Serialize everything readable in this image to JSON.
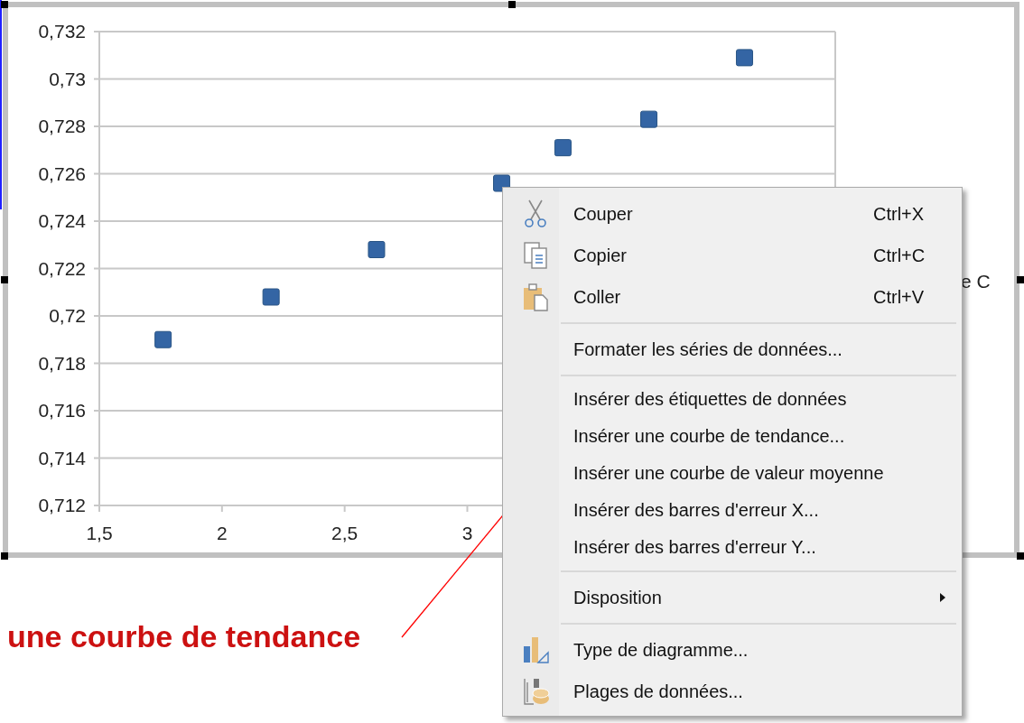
{
  "chart": {
    "chart_data": {
      "type": "scatter",
      "grid": true,
      "x": [
        1.76,
        2.2,
        2.63,
        3.14,
        3.39,
        3.74,
        4.13
      ],
      "series": [
        {
          "name": "e C",
          "color": "#3465a4",
          "values": [
            0.719,
            0.7208,
            0.7228,
            0.7256,
            0.7271,
            0.7283,
            0.7309
          ]
        }
      ],
      "xlim": [
        1.5,
        4.5
      ],
      "ylim": [
        0.712,
        0.732
      ],
      "xticks": [
        {
          "value": 1.5,
          "label": "1,5"
        },
        {
          "value": 2,
          "label": "2"
        },
        {
          "value": 2.5,
          "label": "2,5"
        },
        {
          "value": 3,
          "label": "3"
        }
      ],
      "yticks": [
        {
          "value": 0.712,
          "label": "0,712"
        },
        {
          "value": 0.714,
          "label": "0,714"
        },
        {
          "value": 0.716,
          "label": "0,716"
        },
        {
          "value": 0.718,
          "label": "0,718"
        },
        {
          "value": 0.72,
          "label": "0,72"
        },
        {
          "value": 0.722,
          "label": "0,722"
        },
        {
          "value": 0.724,
          "label": "0,724"
        },
        {
          "value": 0.726,
          "label": "0,726"
        },
        {
          "value": 0.728,
          "label": "0,728"
        },
        {
          "value": 0.73,
          "label": "0,73"
        },
        {
          "value": 0.732,
          "label": "0,732"
        }
      ]
    }
  },
  "context_menu": {
    "items": [
      {
        "kind": "cut",
        "label": "Couper",
        "shortcut": "Ctrl+X"
      },
      {
        "kind": "copy",
        "label": "Copier",
        "shortcut": "Ctrl+C"
      },
      {
        "kind": "paste",
        "label": "Coller",
        "shortcut": "Ctrl+V"
      },
      {
        "kind": "separator"
      },
      {
        "kind": "item",
        "label": "Formater les séries de données..."
      },
      {
        "kind": "separator"
      },
      {
        "kind": "compact",
        "label": "Insérer des étiquettes de données"
      },
      {
        "kind": "compact",
        "label": "Insérer une courbe de tendance..."
      },
      {
        "kind": "compact",
        "label": "Insérer une courbe de valeur moyenne"
      },
      {
        "kind": "compact",
        "label": "Insérer des barres d'erreur X..."
      },
      {
        "kind": "compact",
        "label": "Insérer des barres d'erreur Y..."
      },
      {
        "kind": "separator"
      },
      {
        "kind": "submenu",
        "label": "Disposition"
      },
      {
        "kind": "separator"
      },
      {
        "kind": "chart-type",
        "label": "Type de diagramme..."
      },
      {
        "kind": "data-ranges",
        "label": "Plages de données..."
      }
    ]
  },
  "annotation": {
    "text": "une courbe de tendance"
  }
}
